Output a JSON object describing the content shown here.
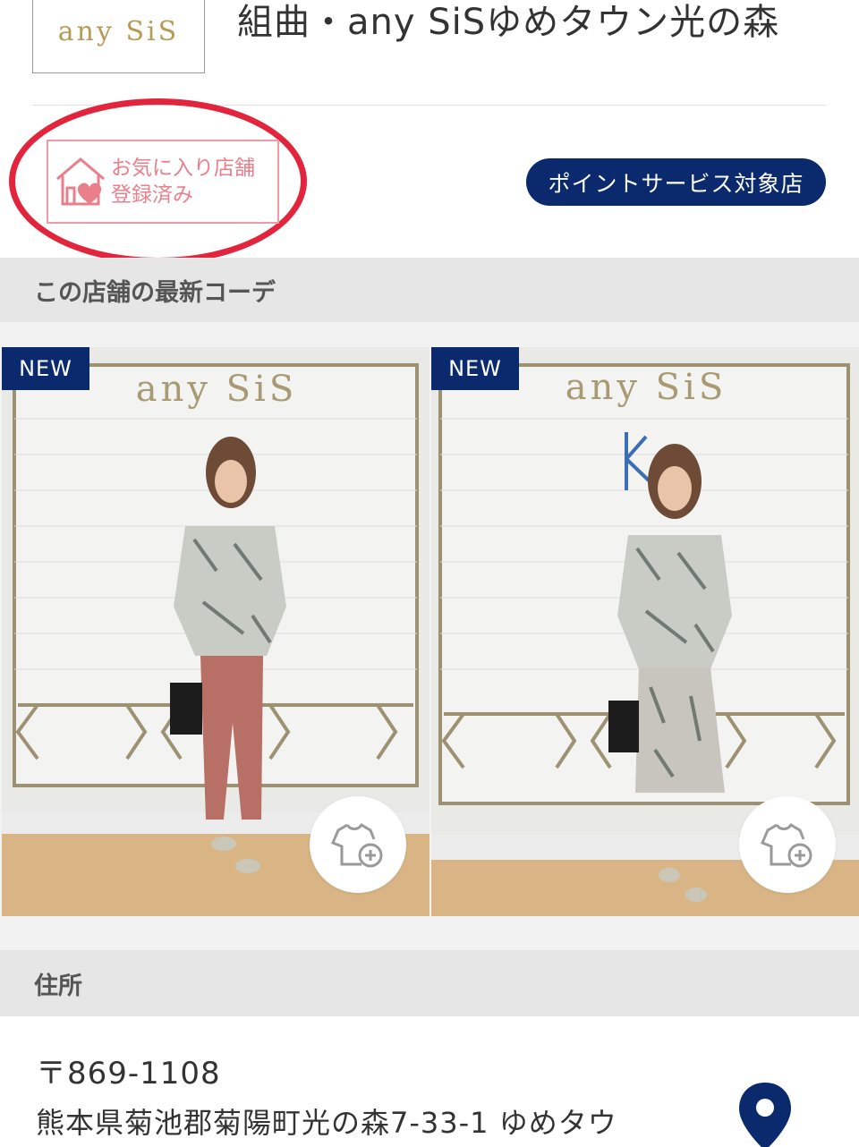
{
  "header": {
    "logo_text": "any SiS",
    "store_title": "組曲・any SiSゆめタウン光の森"
  },
  "favorite": {
    "line1": "お気に入り店舗",
    "line2": "登録済み"
  },
  "point_service_label": "ポイントサービス対象店",
  "coordinates_section": {
    "title": "この店舗の最新コーデ",
    "items": [
      {
        "badge": "NEW",
        "sign": "any SiS",
        "bottom_color": "#b86f66"
      },
      {
        "badge": "NEW",
        "sign": "any SiS",
        "bottom_color": "#c7c5bd"
      }
    ]
  },
  "address_section": {
    "title": "住所",
    "postal": "〒869-1108",
    "line": "熊本県菊池郡菊陽町光の森7-33-1 ゆめタウ"
  },
  "colors": {
    "navy": "#0b2a6e",
    "favorite_pink": "#ea7f8b",
    "highlight_red": "#e3243d",
    "logo_gold": "#b89a55"
  }
}
